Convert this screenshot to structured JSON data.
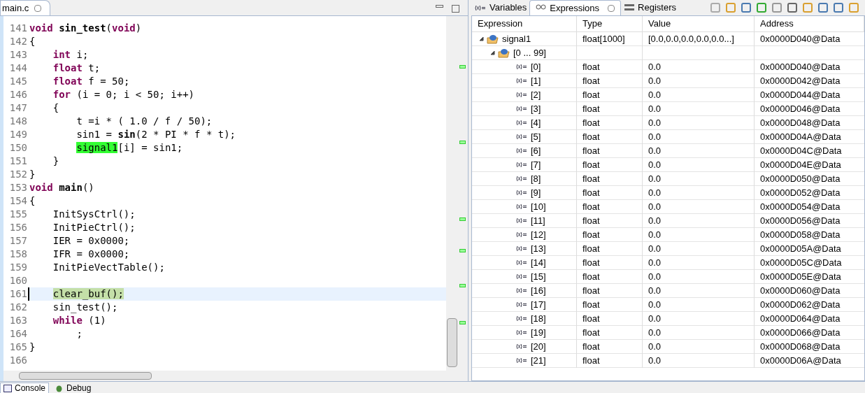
{
  "editor": {
    "tab": {
      "label": "main.c",
      "selected": true
    },
    "lines": [
      {
        "number": "141",
        "current": false,
        "tokens": [
          {
            "text": "void",
            "kind": "keyword"
          },
          {
            "text": " sin_test",
            "kind": "bold"
          },
          {
            "text": "(",
            "kind": "plain"
          },
          {
            "text": "void",
            "kind": "keyword"
          },
          {
            "text": ")",
            "kind": "plain"
          }
        ]
      },
      {
        "number": "142",
        "current": false,
        "tokens": [
          {
            "text": "{",
            "kind": "plain"
          }
        ]
      },
      {
        "number": "143",
        "current": false,
        "tokens": [
          {
            "text": "    int",
            "kind": "keyword"
          },
          {
            "text": " i;",
            "kind": "plain"
          }
        ]
      },
      {
        "number": "144",
        "current": false,
        "tokens": [
          {
            "text": "    float",
            "kind": "keyword"
          },
          {
            "text": " t;",
            "kind": "plain"
          }
        ]
      },
      {
        "number": "145",
        "current": false,
        "tokens": [
          {
            "text": "    float",
            "kind": "keyword"
          },
          {
            "text": " f = 50;",
            "kind": "plain"
          }
        ]
      },
      {
        "number": "146",
        "current": false,
        "tokens": [
          {
            "text": "    for",
            "kind": "keyword"
          },
          {
            "text": " (i = 0; i < 50; i++)",
            "kind": "plain"
          }
        ]
      },
      {
        "number": "147",
        "current": false,
        "tokens": [
          {
            "text": "    {",
            "kind": "plain"
          }
        ]
      },
      {
        "number": "148",
        "current": false,
        "tokens": [
          {
            "text": "        t =i * ( 1.0 / f / 50);",
            "kind": "plain"
          }
        ]
      },
      {
        "number": "149",
        "current": false,
        "tokens": [
          {
            "text": "        sin1 = ",
            "kind": "plain"
          },
          {
            "text": "sin",
            "kind": "bold"
          },
          {
            "text": "(2 * PI * f * t);",
            "kind": "plain"
          }
        ]
      },
      {
        "number": "150",
        "current": false,
        "tokens": [
          {
            "text": "        signal1",
            "kind": "highlight"
          },
          {
            "text": "[i] = sin1;",
            "kind": "plain"
          }
        ]
      },
      {
        "number": "151",
        "current": false,
        "tokens": [
          {
            "text": "    }",
            "kind": "plain"
          }
        ]
      },
      {
        "number": "152",
        "current": false,
        "tokens": [
          {
            "text": "}",
            "kind": "plain"
          }
        ]
      },
      {
        "number": "153",
        "current": false,
        "tokens": [
          {
            "text": "void",
            "kind": "keyword"
          },
          {
            "text": " main",
            "kind": "bold"
          },
          {
            "text": "()",
            "kind": "plain"
          }
        ]
      },
      {
        "number": "154",
        "current": false,
        "tokens": [
          {
            "text": "{",
            "kind": "plain"
          }
        ]
      },
      {
        "number": "155",
        "current": false,
        "tokens": [
          {
            "text": "    InitSysCtrl();",
            "kind": "plain"
          }
        ]
      },
      {
        "number": "156",
        "current": false,
        "tokens": [
          {
            "text": "    InitPieCtrl();",
            "kind": "plain"
          }
        ]
      },
      {
        "number": "157",
        "current": false,
        "tokens": [
          {
            "text": "    IER = 0x0000;",
            "kind": "plain"
          }
        ]
      },
      {
        "number": "158",
        "current": false,
        "tokens": [
          {
            "text": "    IFR = 0x0000;",
            "kind": "plain"
          }
        ]
      },
      {
        "number": "159",
        "current": false,
        "tokens": [
          {
            "text": "    InitPieVectTable();",
            "kind": "plain"
          }
        ]
      },
      {
        "number": "160",
        "current": false
      },
      {
        "number": "161",
        "current": true,
        "tokens": [
          {
            "text": "    clear_buf();",
            "kind": "current"
          }
        ]
      },
      {
        "number": "162",
        "current": false,
        "tokens": [
          {
            "text": "    sin_test();",
            "kind": "plain"
          }
        ]
      },
      {
        "number": "163",
        "current": false,
        "tokens": [
          {
            "text": "    while",
            "kind": "keyword"
          },
          {
            "text": " (1)",
            "kind": "plain"
          }
        ]
      },
      {
        "number": "164",
        "current": false,
        "tokens": [
          {
            "text": "        ;",
            "kind": "plain"
          }
        ]
      },
      {
        "number": "165",
        "current": false,
        "tokens": [
          {
            "text": "}",
            "kind": "plain"
          }
        ]
      },
      {
        "number": "166",
        "current": false
      }
    ]
  },
  "views": {
    "tabs": [
      {
        "label": "Variables",
        "kind": "variables",
        "selected": false
      },
      {
        "label": "Expressions",
        "kind": "expressions",
        "selected": true
      },
      {
        "label": "Registers",
        "kind": "registers",
        "selected": false
      }
    ],
    "table": {
      "columns": [
        "Expression",
        "Type",
        "Value",
        "Address"
      ],
      "rows": [
        {
          "expression": "signal1",
          "type": "float[1000]",
          "value": "[0.0,0.0,0.0,0.0,0.0...]",
          "address": "0x0000D040@Data",
          "kind": "array",
          "expanded": true,
          "children": [
            {
              "expression": "[0 ... 99]",
              "kind": "array",
              "expanded": true,
              "children": [
                {
                  "expression": "[0]",
                  "type": "float",
                  "value": "0.0",
                  "address": "0x0000D040@Data",
                  "kind": "element"
                },
                {
                  "expression": "[1]",
                  "type": "float",
                  "value": "0.0",
                  "address": "0x0000D042@Data",
                  "kind": "element"
                },
                {
                  "expression": "[2]",
                  "type": "float",
                  "value": "0.0",
                  "address": "0x0000D044@Data",
                  "kind": "element"
                },
                {
                  "expression": "[3]",
                  "type": "float",
                  "value": "0.0",
                  "address": "0x0000D046@Data",
                  "kind": "element"
                },
                {
                  "expression": "[4]",
                  "type": "float",
                  "value": "0.0",
                  "address": "0x0000D048@Data",
                  "kind": "element"
                },
                {
                  "expression": "[5]",
                  "type": "float",
                  "value": "0.0",
                  "address": "0x0000D04A@Data",
                  "kind": "element"
                },
                {
                  "expression": "[6]",
                  "type": "float",
                  "value": "0.0",
                  "address": "0x0000D04C@Data",
                  "kind": "element"
                },
                {
                  "expression": "[7]",
                  "type": "float",
                  "value": "0.0",
                  "address": "0x0000D04E@Data",
                  "kind": "element"
                },
                {
                  "expression": "[8]",
                  "type": "float",
                  "value": "0.0",
                  "address": "0x0000D050@Data",
                  "kind": "element"
                },
                {
                  "expression": "[9]",
                  "type": "float",
                  "value": "0.0",
                  "address": "0x0000D052@Data",
                  "kind": "element"
                },
                {
                  "expression": "[10]",
                  "type": "float",
                  "value": "0.0",
                  "address": "0x0000D054@Data",
                  "kind": "element"
                },
                {
                  "expression": "[11]",
                  "type": "float",
                  "value": "0.0",
                  "address": "0x0000D056@Data",
                  "kind": "element"
                },
                {
                  "expression": "[12]",
                  "type": "float",
                  "value": "0.0",
                  "address": "0x0000D058@Data",
                  "kind": "element"
                },
                {
                  "expression": "[13]",
                  "type": "float",
                  "value": "0.0",
                  "address": "0x0000D05A@Data",
                  "kind": "element"
                },
                {
                  "expression": "[14]",
                  "type": "float",
                  "value": "0.0",
                  "address": "0x0000D05C@Data",
                  "kind": "element"
                },
                {
                  "expression": "[15]",
                  "type": "float",
                  "value": "0.0",
                  "address": "0x0000D05E@Data",
                  "kind": "element"
                },
                {
                  "expression": "[16]",
                  "type": "float",
                  "value": "0.0",
                  "address": "0x0000D060@Data",
                  "kind": "element"
                },
                {
                  "expression": "[17]",
                  "type": "float",
                  "value": "0.0",
                  "address": "0x0000D062@Data",
                  "kind": "element"
                },
                {
                  "expression": "[18]",
                  "type": "float",
                  "value": "0.0",
                  "address": "0x0000D064@Data",
                  "kind": "element"
                },
                {
                  "expression": "[19]",
                  "type": "float",
                  "value": "0.0",
                  "address": "0x0000D066@Data",
                  "kind": "element"
                },
                {
                  "expression": "[20]",
                  "type": "float",
                  "value": "0.0",
                  "address": "0x0000D068@Data",
                  "kind": "element"
                },
                {
                  "expression": "[21]",
                  "type": "float",
                  "value": "0.0",
                  "address": "0x0000D06A@Data",
                  "kind": "element"
                }
              ]
            }
          ]
        }
      ]
    }
  },
  "bottom_tabs": [
    {
      "label": "Console",
      "kind": "console",
      "selected": true
    },
    {
      "label": "Debug",
      "kind": "debug",
      "selected": false
    }
  ]
}
